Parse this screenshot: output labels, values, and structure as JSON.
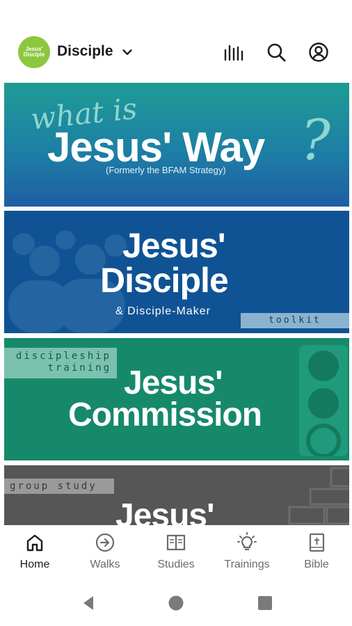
{
  "header": {
    "logo_text": "Jesus' Disciple",
    "app_title": "Disciple",
    "icons": [
      "chevron-down-icon",
      "library-icon",
      "search-icon",
      "account-icon"
    ]
  },
  "banners": [
    {
      "script_text": "what is",
      "title": "Jesus' Way",
      "question_mark": "?",
      "subtitle": "(Formerly the BFAM Strategy)"
    },
    {
      "title_line1": "Jesus'",
      "title_line2": "Disciple",
      "subtitle": "& Disciple-Maker",
      "tag": "toolkit"
    },
    {
      "tag_line1": "discipleship",
      "tag_line2": "training",
      "title_line1": "Jesus'",
      "title_line2": "Commission"
    },
    {
      "tag": "group study",
      "title_line1": "Jesus'"
    }
  ],
  "bottom_nav": {
    "items": [
      {
        "label": "Home",
        "icon": "home-icon",
        "active": true
      },
      {
        "label": "Walks",
        "icon": "arrow-circle-icon",
        "active": false
      },
      {
        "label": "Studies",
        "icon": "book-open-icon",
        "active": false
      },
      {
        "label": "Trainings",
        "icon": "lightbulb-icon",
        "active": false
      },
      {
        "label": "Bible",
        "icon": "bible-icon",
        "active": false
      }
    ]
  },
  "colors": {
    "logo": "#8dc63f",
    "banner_way": "#1d7fa5",
    "banner_disciple": "#0f5394",
    "banner_commission": "#17896b",
    "banner_group": "#565656"
  }
}
